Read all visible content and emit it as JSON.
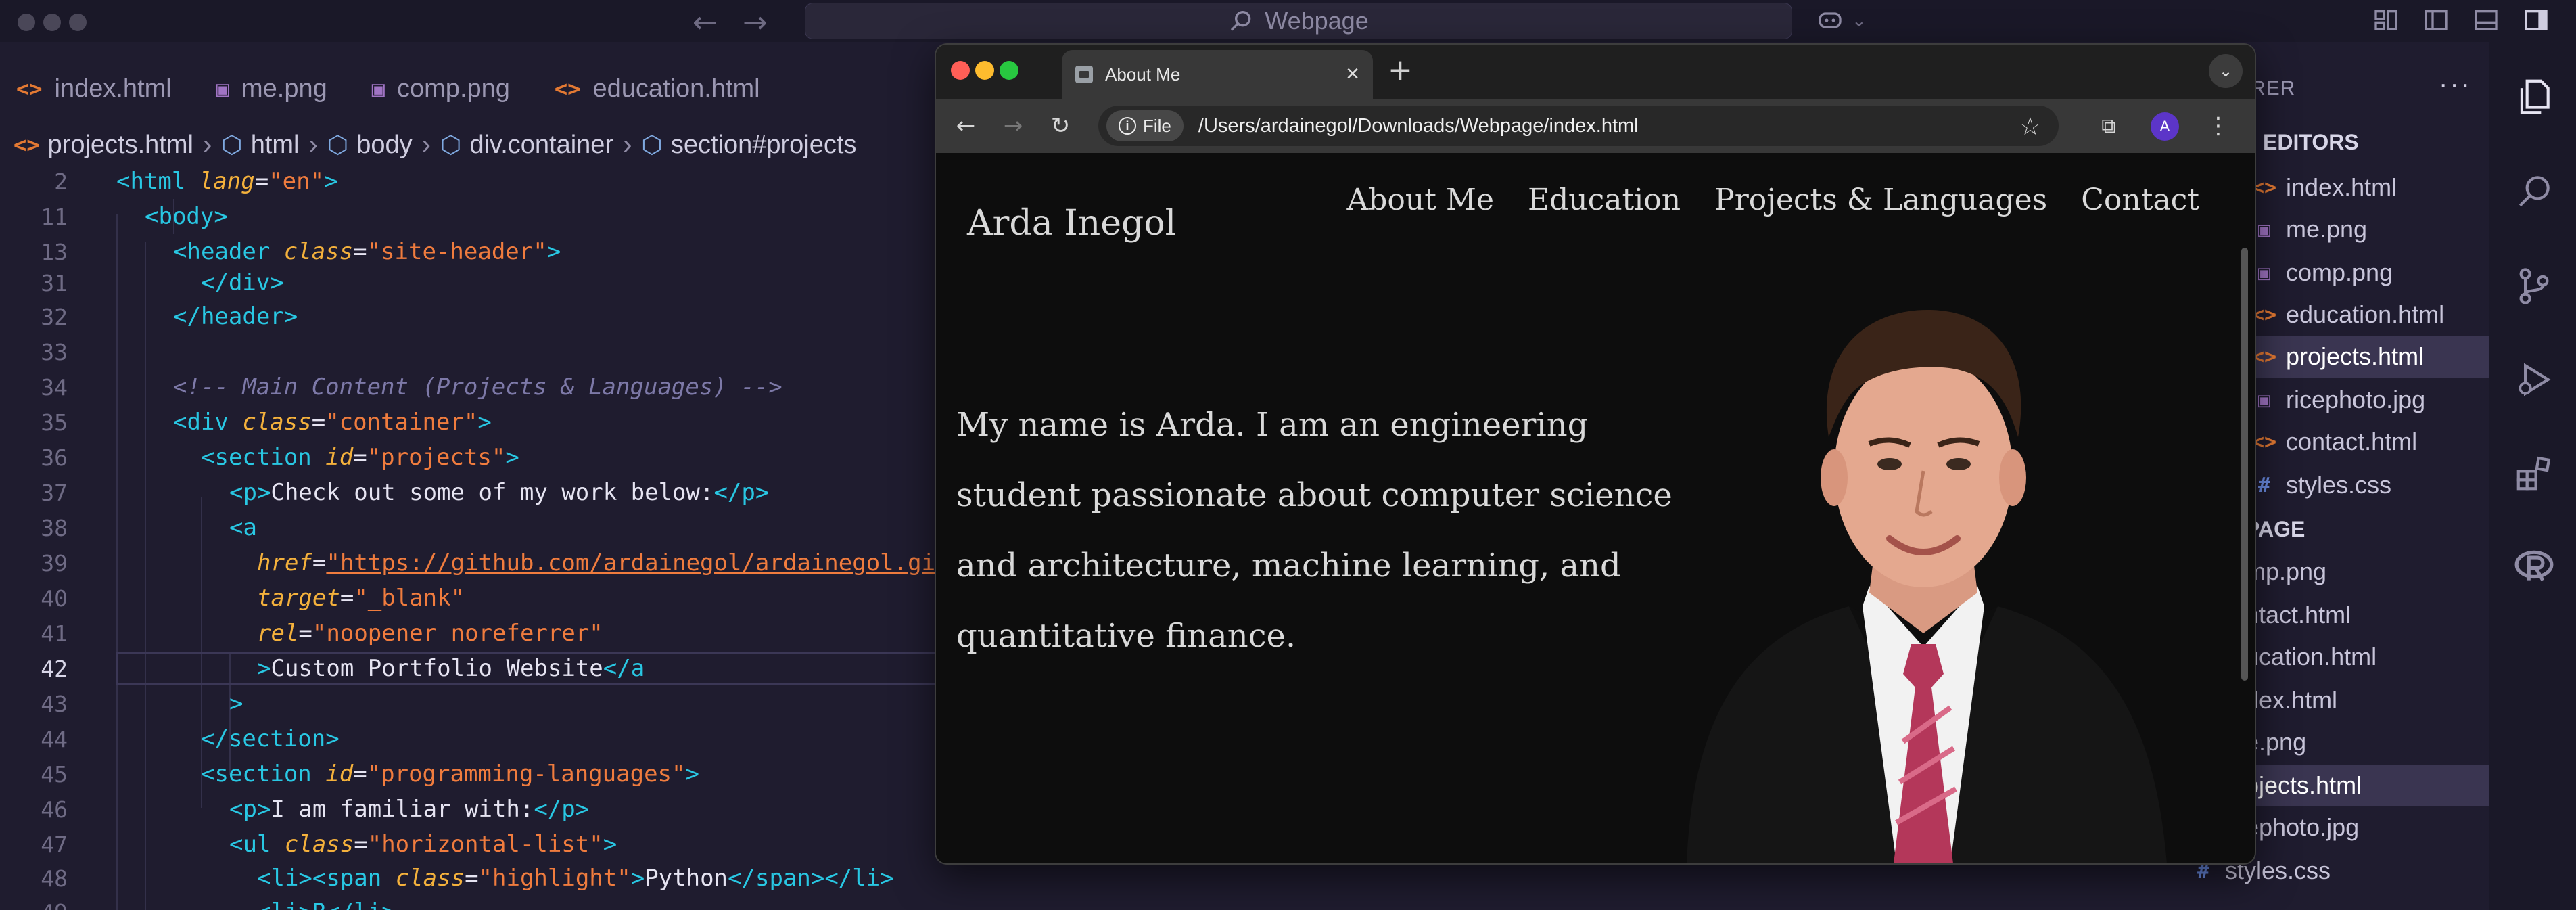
{
  "vscode": {
    "command_center": "Webpage",
    "tabs": [
      {
        "label": "index.html",
        "icon": "html"
      },
      {
        "label": "me.png",
        "icon": "image"
      },
      {
        "label": "comp.png",
        "icon": "image"
      },
      {
        "label": "education.html",
        "icon": "html"
      }
    ],
    "breadcrumbs": [
      "projects.html",
      "html",
      "body",
      "div.container",
      "section#projects"
    ],
    "code_lines": {
      "l2": {
        "num": "2",
        "tag_open": "<html ",
        "attr": "lang",
        "eq": "=",
        "val": "\"en\"",
        "tag_close": ">"
      },
      "l11": {
        "num": "11",
        "tag": "<body>"
      },
      "l13": {
        "num": "13",
        "tag_open": "<header ",
        "attr": "class",
        "eq": "=",
        "val": "\"site-header\"",
        "tag_close": ">"
      },
      "l31": {
        "num": "31",
        "tag": "</div>"
      },
      "l32": {
        "num": "32",
        "tag": "</header>"
      },
      "l33": {
        "num": "33"
      },
      "l34": {
        "num": "34",
        "comment": "<!-- Main Content (Projects & Languages) -->"
      },
      "l35": {
        "num": "35",
        "tag_open": "<div ",
        "attr": "class",
        "eq": "=",
        "val": "\"container\"",
        "tag_close": ">"
      },
      "l36": {
        "num": "36",
        "tag_open": "<section ",
        "attr": "id",
        "eq": "=",
        "val": "\"projects\"",
        "tag_close": ">"
      },
      "l37": {
        "num": "37",
        "tag_open": "<p>",
        "text": "Check out some of my work below:",
        "tag_close": "</p>"
      },
      "l38": {
        "num": "38",
        "tag": "<a"
      },
      "l39": {
        "num": "39",
        "attr": "href",
        "eq": "=",
        "val": "\"https://github.com/ardainegol/ardainegol.github.io\""
      },
      "l40": {
        "num": "40",
        "attr": "target",
        "eq": "=",
        "val": "\"_blank\""
      },
      "l41": {
        "num": "41",
        "attr": "rel",
        "eq": "=",
        "val": "\"noopener noreferrer\""
      },
      "l42": {
        "num": "42",
        "tag_open": ">",
        "text": "Custom Portfolio Website",
        "tag_close": "</a"
      },
      "l43": {
        "num": "43",
        "tag": ">"
      },
      "l44": {
        "num": "44",
        "tag": "</section>"
      },
      "l45": {
        "num": "45",
        "tag_open": "<section ",
        "attr": "id",
        "eq": "=",
        "val": "\"programming-languages\"",
        "tag_close": ">"
      },
      "l46": {
        "num": "46",
        "tag_open": "<p>",
        "text": "I am familiar with:",
        "tag_close": "</p>"
      },
      "l47": {
        "num": "47",
        "tag_open": "<ul ",
        "attr": "class",
        "eq": "=",
        "val": "\"horizontal-list\"",
        "tag_close": ">"
      },
      "l48": {
        "num": "48",
        "tag_open": "<li><span ",
        "attr": "class",
        "eq": "=",
        "val": "\"highlight\"",
        "tag_mid": ">",
        "text": "Python",
        "tag_close": "</span></li>"
      },
      "l49": {
        "num": "49",
        "tag": "<li>R</li>"
      }
    },
    "explorer": {
      "header": "RER",
      "more": "···",
      "open_editors_label": "EDITORS",
      "open_editors": [
        {
          "label": "index.html",
          "icon": "html"
        },
        {
          "label": "me.png",
          "icon": "image"
        },
        {
          "label": "comp.png",
          "icon": "image"
        },
        {
          "label": "education.html",
          "icon": "html"
        },
        {
          "label": "projects.html",
          "icon": "html",
          "active": true
        },
        {
          "label": "ricephoto.jpg",
          "icon": "image"
        },
        {
          "label": "contact.html",
          "icon": "html"
        },
        {
          "label": "styles.css",
          "icon": "css"
        }
      ],
      "folder_label": "PAGE",
      "folder_items": [
        {
          "label": "mp.png"
        },
        {
          "label": "ntact.html"
        },
        {
          "label": "ucation.html"
        },
        {
          "label": "dex.html"
        },
        {
          "label": "e.png"
        },
        {
          "label": "ojects.html",
          "active": true
        },
        {
          "label": "ephoto.jpg"
        }
      ],
      "bottom_item": {
        "label": "styles.css",
        "icon_glyph": "#"
      }
    }
  },
  "browser": {
    "tab_title": "About Me",
    "chip_label": "File",
    "url": "/Users/ardainegol/Downloads/Webpage/index.html",
    "avatar_initial": "A",
    "site": {
      "title": "Arda Inegol",
      "nav": [
        "About Me",
        "Education",
        "Projects & Languages",
        "Contact"
      ],
      "bio": "My name is Arda. I am an engineering student passionate about computer science and architecture, machine learning, and quantitative finance."
    }
  }
}
